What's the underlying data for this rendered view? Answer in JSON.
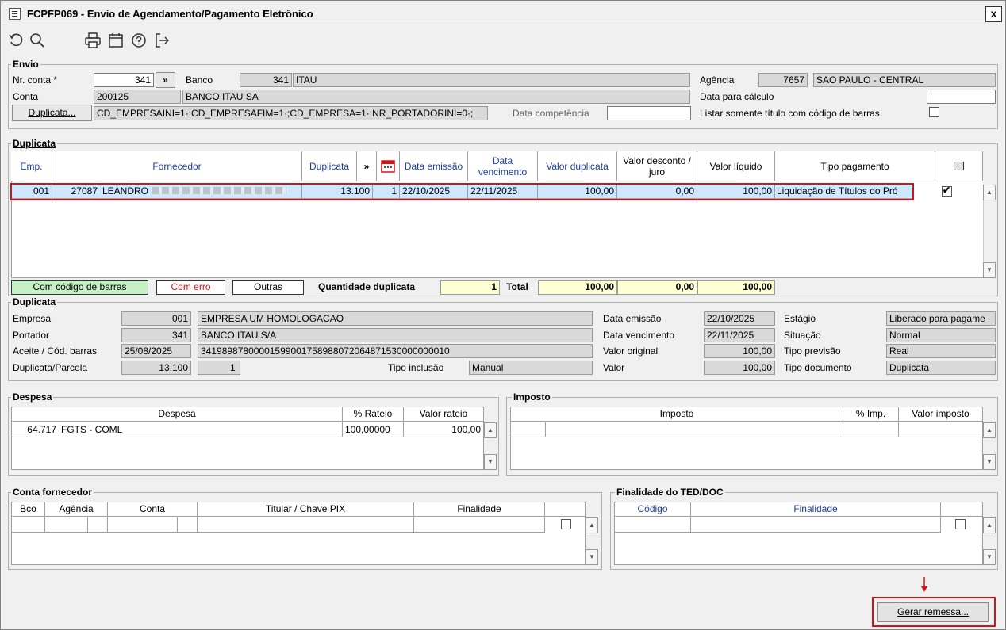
{
  "window": {
    "title": "FCPFP069 - Envio de Agendamento/Pagamento Eletrônico",
    "close_label": "x"
  },
  "toolbar": [
    "undo-icon",
    "search-icon",
    "print-icon",
    "calendar-icon",
    "help-icon",
    "exit-icon"
  ],
  "envio": {
    "group_title": "Envio",
    "nr_conta_label": "Nr. conta *",
    "nr_conta_value": "341",
    "nr_conta_button": "»",
    "banco_label": "Banco",
    "banco_code": "341",
    "banco_name": "ITAU",
    "agencia_label": "Agência",
    "agencia_code": "7657",
    "agencia_name": "SAO PAULO - CENTRAL",
    "conta_label": "Conta",
    "conta_value": "200125",
    "conta_name": "BANCO ITAU SA",
    "data_calculo_label": "Data para cálculo",
    "data_calculo_value": "",
    "duplicata_button": "Duplicata...",
    "filter_value": "CD_EMPRESAINI=1·;CD_EMPRESAFIM=1·;CD_EMPRESA=1·;NR_PORTADORINI=0·;",
    "data_competencia_label": "Data competência",
    "data_competencia_value": "",
    "listar_label": "Listar somente título com código de barras"
  },
  "duplicata_grid": {
    "group_title": "Duplicata",
    "headers": {
      "emp": "Emp.",
      "fornecedor": "Fornecedor",
      "duplicata": "Duplicata",
      "nav": "»",
      "data_emissao": "Data emissão",
      "data_vencimento": "Data vencimento",
      "valor_duplicata": "Valor duplicata",
      "valor_desconto": "Valor desconto / juro",
      "valor_liquido": "Valor líquido",
      "tipo_pagamento": "Tipo pagamento"
    },
    "row": {
      "emp": "001",
      "fornecedor_code": "27087",
      "fornecedor_name": "LEANDRO",
      "duplicata": "13.100",
      "parcela": "1",
      "data_emissao": "22/10/2025",
      "data_vencimento": "22/11/2025",
      "valor_duplicata": "100,00",
      "valor_desconto": "0,00",
      "valor_liquido": "100,00",
      "tipo_pagamento": "Liquidação de Títulos do Pró"
    },
    "legend": {
      "com_codigo": "Com código de barras",
      "com_erro": "Com erro",
      "outras": "Outras"
    },
    "quantidade_label": "Quantidade duplicata",
    "quantidade_value": "1",
    "total_label": "Total",
    "total_duplicata": "100,00",
    "total_desconto": "0,00",
    "total_liquido": "100,00"
  },
  "detalhe": {
    "group_title": "Duplicata",
    "empresa_label": "Empresa",
    "empresa_code": "001",
    "empresa_name": "EMPRESA UM HOMOLOGACAO",
    "portador_label": "Portador",
    "portador_code": "341",
    "portador_name": "BANCO ITAU S/A",
    "aceite_label": "Aceite / Cód. barras",
    "aceite_date": "25/08/2025",
    "barcode": "34198987800001599001758988072064871530000000010",
    "dup_parcela_label": "Duplicata/Parcela",
    "dup_value": "13.100",
    "parcela_value": "1",
    "tipo_inclusao_label": "Tipo inclusão",
    "tipo_inclusao_value": "Manual",
    "data_emissao_label": "Data emissão",
    "data_emissao_value": "22/10/2025",
    "data_vencimento_label": "Data vencimento",
    "data_vencimento_value": "22/11/2025",
    "valor_original_label": "Valor original",
    "valor_original_value": "100,00",
    "valor_label": "Valor",
    "valor_value": "100,00",
    "estagio_label": "Estágio",
    "estagio_value": "Liberado para pagame",
    "situacao_label": "Situação",
    "situacao_value": "Normal",
    "tipo_previsao_label": "Tipo previsão",
    "tipo_previsao_value": "Real",
    "tipo_documento_label": "Tipo documento",
    "tipo_documento_value": "Duplicata"
  },
  "despesa": {
    "group_title": "Despesa",
    "headers": {
      "despesa": "Despesa",
      "rateio": "% Rateio",
      "valor": "Valor rateio"
    },
    "row": {
      "code": "64.717",
      "name": "FGTS - COML",
      "rateio": "100,00000",
      "valor": "100,00"
    }
  },
  "imposto": {
    "group_title": "Imposto",
    "headers": {
      "imposto": "Imposto",
      "pct": "% Imp.",
      "valor": "Valor imposto"
    }
  },
  "conta_fornecedor": {
    "group_title": "Conta fornecedor",
    "headers": {
      "bco": "Bco",
      "agencia": "Agência",
      "conta": "Conta",
      "titular": "Titular / Chave PIX",
      "finalidade": "Finalidade"
    }
  },
  "finalidade_ted": {
    "group_title": "Finalidade do TED/DOC",
    "headers": {
      "codigo": "Código",
      "finalidade": "Finalidade"
    }
  },
  "actions": {
    "gerar_remessa": "Gerar remessa..."
  },
  "colors": {
    "highlight_red": "#d0141c",
    "header_blue": "#1f3e9c",
    "legend_green": "#c6f0c6",
    "totals_yellow": "#ffffd6",
    "row_selected": "#cde8ff"
  }
}
